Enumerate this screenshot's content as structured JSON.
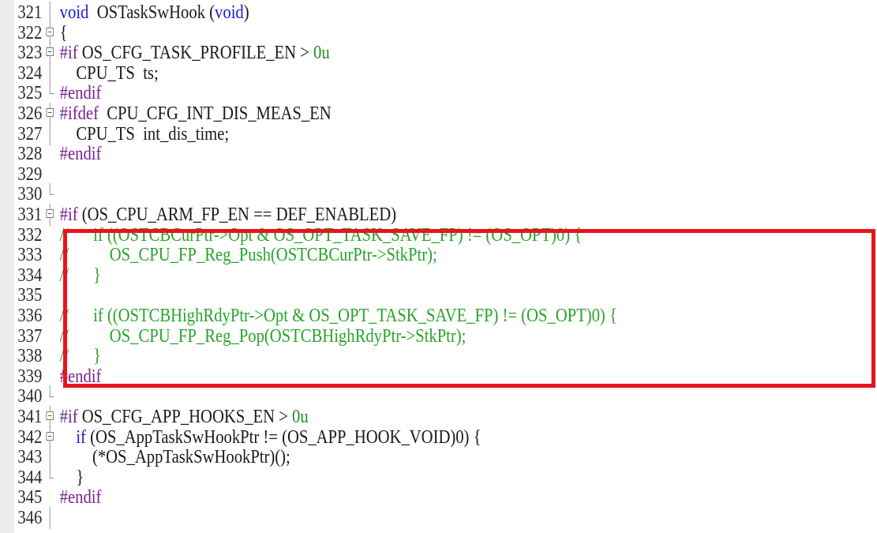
{
  "editor": {
    "lines": [
      {
        "num": "321",
        "fold": "line",
        "parts": [
          [
            "kw",
            "void"
          ],
          [
            "t",
            "  OSTaskSwHook "
          ],
          [
            "t",
            "("
          ],
          [
            "kw",
            "void"
          ],
          [
            "t",
            ")"
          ]
        ]
      },
      {
        "num": "322",
        "fold": "box",
        "parts": [
          [
            "t",
            "{"
          ]
        ]
      },
      {
        "num": "323",
        "fold": "box",
        "parts": [
          [
            "pp",
            "#if"
          ],
          [
            "t",
            " OS_CFG_TASK_PROFILE_EN > "
          ],
          [
            "num",
            "0u"
          ]
        ]
      },
      {
        "num": "324",
        "fold": "line",
        "parts": [
          [
            "t",
            "    CPU_TS  ts;"
          ]
        ]
      },
      {
        "num": "325",
        "fold": "end",
        "parts": [
          [
            "pp",
            "#endif"
          ]
        ]
      },
      {
        "num": "326",
        "fold": "box",
        "parts": [
          [
            "pp",
            "#ifdef"
          ],
          [
            "t",
            "  CPU_CFG_INT_DIS_MEAS_EN"
          ]
        ]
      },
      {
        "num": "327",
        "fold": "line",
        "parts": [
          [
            "t",
            "    CPU_TS  int_dis_time;"
          ]
        ]
      },
      {
        "num": "328",
        "fold": "none",
        "parts": [
          [
            "pp",
            "#endif"
          ]
        ]
      },
      {
        "num": "329",
        "fold": "none",
        "parts": []
      },
      {
        "num": "330",
        "fold": "end",
        "parts": []
      },
      {
        "num": "331",
        "fold": "box",
        "parts": [
          [
            "pp",
            "#if"
          ],
          [
            "t",
            " (OS_CPU_ARM_FP_EN == DEF_ENABLED)"
          ]
        ]
      },
      {
        "num": "332",
        "fold": "none",
        "parts": [
          [
            "cm",
            "//      if ((OSTCBCurPtr->Opt & OS_OPT_TASK_SAVE_FP) != (OS_OPT)0) {"
          ]
        ]
      },
      {
        "num": "333",
        "fold": "none",
        "parts": [
          [
            "cm",
            "//          OS_CPU_FP_Reg_Push(OSTCBCurPtr->StkPtr);"
          ]
        ]
      },
      {
        "num": "334",
        "fold": "none",
        "parts": [
          [
            "cm",
            "//      }"
          ]
        ]
      },
      {
        "num": "335",
        "fold": "none",
        "parts": []
      },
      {
        "num": "336",
        "fold": "none",
        "parts": [
          [
            "cm",
            "//      if ((OSTCBHighRdyPtr->Opt & OS_OPT_TASK_SAVE_FP) != (OS_OPT)0) {"
          ]
        ]
      },
      {
        "num": "337",
        "fold": "none",
        "parts": [
          [
            "cm",
            "//          OS_CPU_FP_Reg_Pop(OSTCBHighRdyPtr->StkPtr);"
          ]
        ]
      },
      {
        "num": "338",
        "fold": "none",
        "parts": [
          [
            "cm",
            "//      }"
          ]
        ]
      },
      {
        "num": "339",
        "fold": "none",
        "parts": [
          [
            "pp",
            "#endif"
          ]
        ]
      },
      {
        "num": "340",
        "fold": "end",
        "parts": []
      },
      {
        "num": "341",
        "fold": "box",
        "parts": [
          [
            "pp",
            "#if"
          ],
          [
            "t",
            " OS_CFG_APP_HOOKS_EN > "
          ],
          [
            "num",
            "0u"
          ]
        ]
      },
      {
        "num": "342",
        "fold": "box",
        "parts": [
          [
            "t",
            "    "
          ],
          [
            "kw",
            "if"
          ],
          [
            "t",
            " (OS_AppTaskSwHookPtr != (OS_APP_HOOK_VOID)0) {"
          ]
        ]
      },
      {
        "num": "343",
        "fold": "line",
        "parts": [
          [
            "t",
            "        (*OS_AppTaskSwHookPtr)();"
          ]
        ]
      },
      {
        "num": "344",
        "fold": "end",
        "parts": [
          [
            "t",
            "    }"
          ]
        ]
      },
      {
        "num": "345",
        "fold": "none",
        "parts": [
          [
            "pp",
            "#endif"
          ]
        ]
      },
      {
        "num": "346",
        "fold": "line",
        "parts": []
      }
    ]
  },
  "colors": {
    "keyword": "#1a1ad6",
    "preprocessor": "#7b1f93",
    "comment": "#28a428",
    "highlight_border": "#e8141c"
  }
}
